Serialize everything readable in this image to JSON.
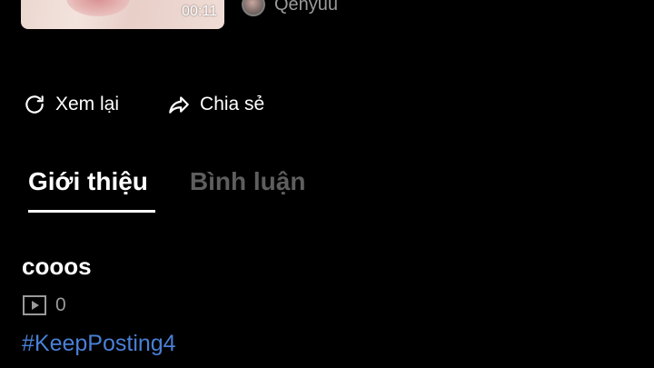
{
  "video": {
    "duration": "00:11",
    "channel_name": "Qenyuu"
  },
  "actions": {
    "replay_label": "Xem lại",
    "share_label": "Chia sẻ"
  },
  "tabs": [
    {
      "label": "Giới thiệu",
      "active": true
    },
    {
      "label": "Bình luận",
      "active": false
    }
  ],
  "details": {
    "title": "cooos",
    "view_count": "0",
    "hashtag": "#KeepPosting4"
  },
  "colors": {
    "background": "#000000",
    "hashtag": "#4a7fd6",
    "inactive_tab": "#5e5e5e",
    "muted_text": "#9a9a9a"
  },
  "icons": {
    "replay": "replay-icon",
    "share": "share-icon",
    "views": "play-box-icon"
  }
}
